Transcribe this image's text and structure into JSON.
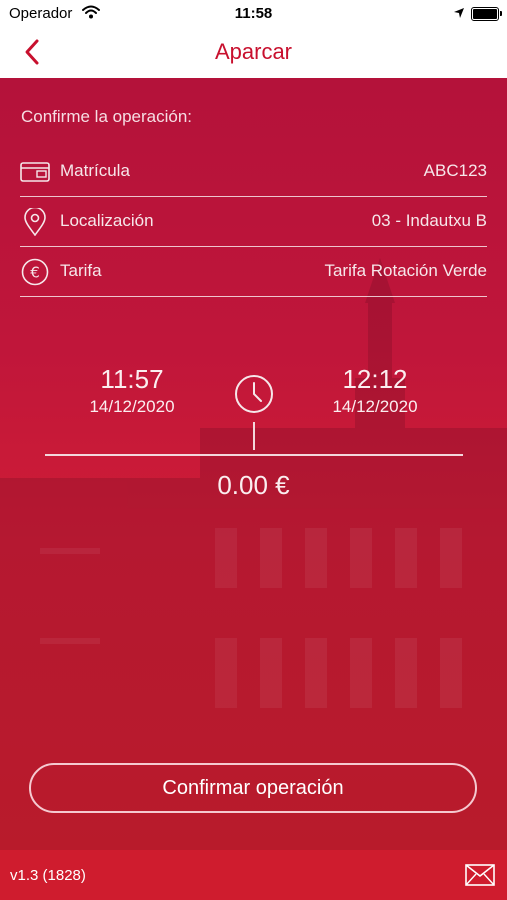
{
  "status_bar": {
    "carrier": "Operador",
    "time": "11:58"
  },
  "nav": {
    "title": "Aparcar"
  },
  "confirm": {
    "heading": "Confirme la operación:",
    "rows": [
      {
        "icon": "license-plate-icon",
        "label": "Matrícula",
        "value": "ABC123"
      },
      {
        "icon": "location-pin-icon",
        "label": "Localización",
        "value": "03 - Indautxu B"
      },
      {
        "icon": "euro-icon",
        "label": "Tarifa",
        "value": "Tarifa Rotación Verde"
      }
    ]
  },
  "times": {
    "start": {
      "time": "11:57",
      "date": "14/12/2020"
    },
    "end": {
      "time": "12:12",
      "date": "14/12/2020"
    }
  },
  "price": "0.00 €",
  "action": {
    "confirm_label": "Confirmar operación"
  },
  "footer": {
    "version": "v1.3 (1828)"
  },
  "colors": {
    "brand_red": "#c8102e",
    "bottom_bar": "#cf1c2e"
  }
}
